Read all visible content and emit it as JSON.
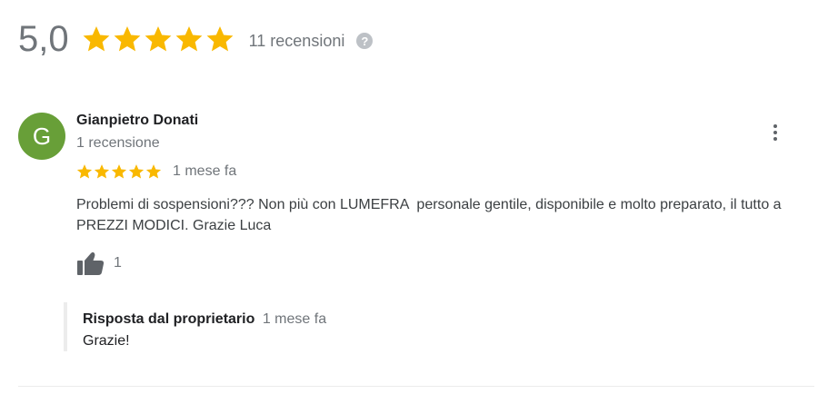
{
  "summary": {
    "rating": "5,0",
    "stars": 5,
    "review_count": "11 recensioni",
    "help_icon": "help-icon",
    "star_color": "#f9b800"
  },
  "review": {
    "avatar_letter": "G",
    "avatar_color": "#689f38",
    "author_name": "Gianpietro Donati",
    "author_meta": "1 recensione",
    "stars": 5,
    "date": "1 mese fa",
    "text": "Problemi di sospensioni??? Non più con LUMEFRA  personale gentile, disponibile e molto preparato, il tutto a PREZZI MODICI. Grazie Luca",
    "like_icon": "thumbs-up-icon",
    "like_count": "1",
    "more_icon": "more-vertical-icon"
  },
  "owner_response": {
    "title": "Risposta dal proprietario",
    "date": "1 mese fa",
    "text": "Grazie!"
  }
}
